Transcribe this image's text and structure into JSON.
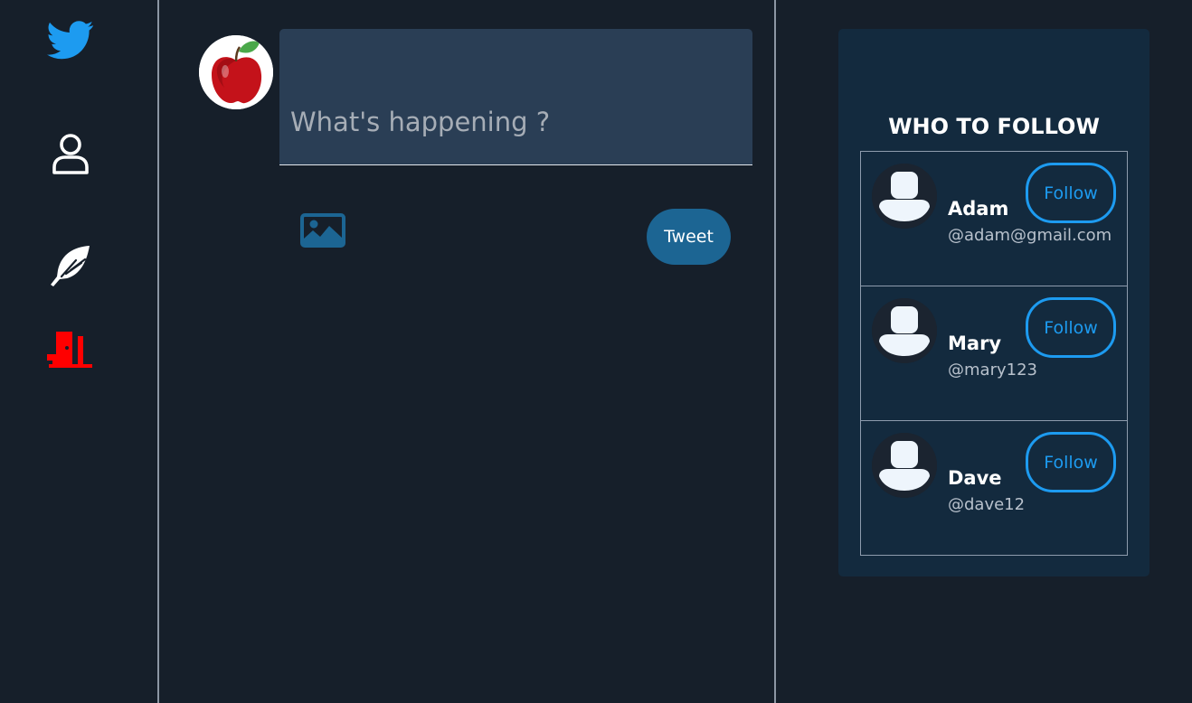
{
  "sidebar": {
    "items": [
      {
        "icon": "twitter-bird-icon",
        "color": "#1d9bf0"
      },
      {
        "icon": "profile-icon",
        "color": "#ffffff"
      },
      {
        "icon": "feather-quill-icon",
        "color": "#ffffff"
      },
      {
        "icon": "logout-door-icon",
        "color": "#ff0000"
      }
    ]
  },
  "composer": {
    "placeholder": "What's happening ?",
    "value": "",
    "avatar": "apple-avatar-image",
    "image_icon": "image-upload-icon",
    "tweet_label": "Tweet"
  },
  "who_to_follow": {
    "title": "WHO TO FOLLOW",
    "users": [
      {
        "name": "Adam",
        "handle": "@adam@gmail.com",
        "follow_label": "Follow"
      },
      {
        "name": "Mary",
        "handle": "@mary123",
        "follow_label": "Follow"
      },
      {
        "name": "Dave",
        "handle": "@dave12",
        "follow_label": "Follow"
      }
    ]
  },
  "colors": {
    "background": "#161f2a",
    "accent": "#1d9bf0",
    "tweet_button": "#1c6593",
    "panel": "#132a3e",
    "composer": "#2a3e55",
    "logout": "#ff0000"
  }
}
